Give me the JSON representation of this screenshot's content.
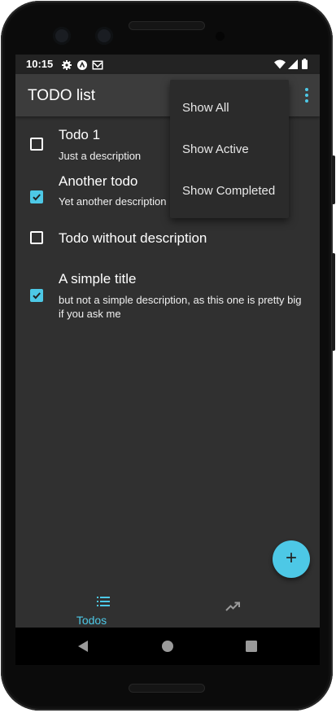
{
  "status_bar": {
    "time": "10:15"
  },
  "app_bar": {
    "title": "TODO list"
  },
  "menu": {
    "items": [
      {
        "label": "Show All"
      },
      {
        "label": "Show Active"
      },
      {
        "label": "Show Completed"
      }
    ]
  },
  "todos": [
    {
      "title": "Todo 1",
      "description": "Just a description",
      "completed": false
    },
    {
      "title": "Another todo",
      "description": "Yet another description",
      "completed": true
    },
    {
      "title": "Todo without description",
      "description": "",
      "completed": false
    },
    {
      "title": "A simple title",
      "description": "but not a simple description, as this one is pretty big if you ask me",
      "completed": true
    }
  ],
  "fab": {
    "icon": "add-icon",
    "glyph": "+"
  },
  "bottom_nav": {
    "tabs": [
      {
        "label": "Todos",
        "icon": "list-icon",
        "active": true
      },
      {
        "label": "",
        "icon": "trending-up-icon",
        "active": false
      }
    ]
  },
  "colors": {
    "accent": "#4dc8e6",
    "background": "#303030",
    "app_bar": "#3c3c3c",
    "status_bar": "#232323"
  }
}
